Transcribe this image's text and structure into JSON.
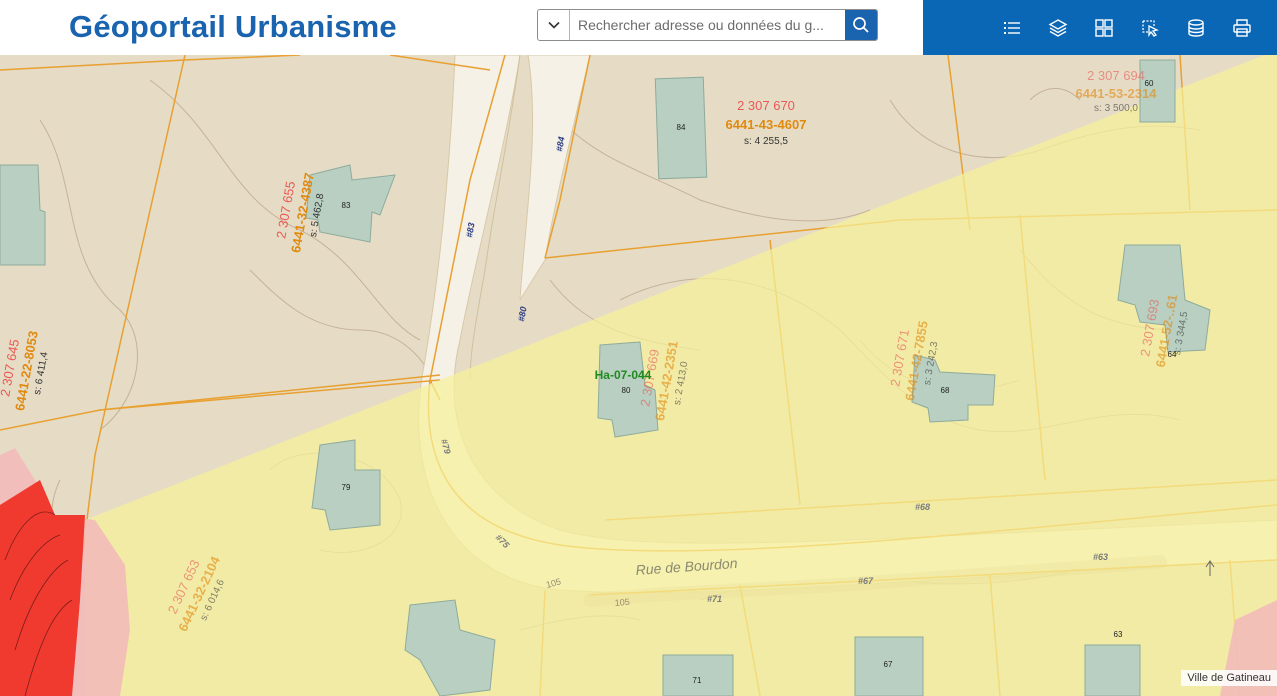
{
  "header": {
    "title": "Géoportail Urbanisme",
    "search_placeholder": "Rechercher adresse ou données du g..."
  },
  "toolbar": {
    "icons": [
      "list-icon",
      "layers-icon",
      "grid-icon",
      "select-icon",
      "database-icon",
      "print-icon"
    ]
  },
  "map": {
    "zone_label": "Ha-07-044",
    "street_name": "Rue de Bourdon",
    "attribution": "Ville de Gatineau",
    "lots": [
      {
        "id": "2 307 670",
        "num": "6441-43-4607",
        "area": "s: 4 255,5"
      },
      {
        "id": "2 307 655",
        "num": "6441-32-4387",
        "area": "s: 5 462,8"
      },
      {
        "id": "2 307 645",
        "num": "6441-22-8053",
        "area": "s: 6 411,4"
      },
      {
        "id": "2 307 669",
        "num": "6441-42-2351",
        "area": "s: 2 413,0"
      },
      {
        "id": "2 307 671",
        "num": "6441-42-7855",
        "area": "s: 3 242,3"
      },
      {
        "id": "2 307 694",
        "num": "6441-53-2314",
        "area": "s: 3 500,0"
      },
      {
        "id": "2 307 693",
        "num": "6441-52-..61",
        "area": "s: 3 344,5"
      },
      {
        "id": "2 307 653",
        "num": "6441-32-2104",
        "area": "s: 6 014,6"
      }
    ],
    "houses": [
      "84",
      "83",
      "80",
      "68",
      "79",
      "60",
      "64",
      "71",
      "67",
      "63"
    ],
    "civic": [
      "#84",
      "#83",
      "#80",
      "#79",
      "#75",
      "#68",
      "#67",
      "#71",
      "#63"
    ],
    "contours": [
      "105",
      "105"
    ]
  },
  "colors": {
    "brand": "#1a63ae",
    "toolbar": "#0a67b5",
    "lot_line": "#e8a030",
    "zone_yellow": "#f5f0a8",
    "zone_red": "#f03030",
    "zone_pink": "#f2b8b8",
    "ground": "#e6dcc6",
    "building": "#b8cfc2"
  }
}
